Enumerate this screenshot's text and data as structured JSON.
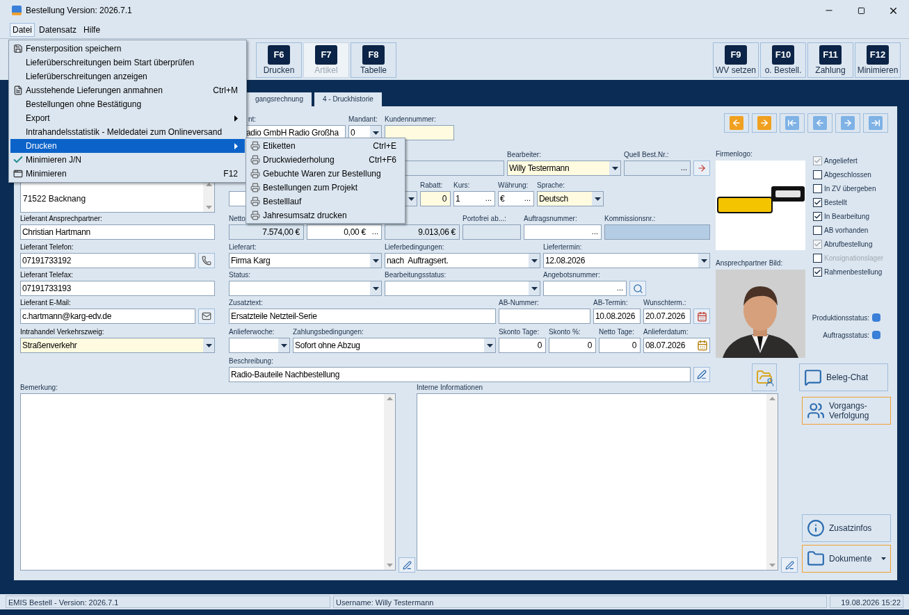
{
  "window": {
    "title": "Bestellung Version: 2026.7.1"
  },
  "menubar": [
    {
      "label": "Datei",
      "selected": true
    },
    {
      "label": "Datensatz",
      "selected": false
    },
    {
      "label": "Hilfe",
      "selected": false
    }
  ],
  "toolbar_left": [
    {
      "key": "F6",
      "label": "Drucken",
      "disabled": false
    },
    {
      "key": "F7",
      "label": "Artikel",
      "disabled": true
    },
    {
      "key": "F8",
      "label": "Tabelle",
      "disabled": false
    }
  ],
  "toolbar_right": [
    {
      "key": "F9",
      "label": "WV setzen",
      "disabled": false
    },
    {
      "key": "F10",
      "label": "o. Bestell.",
      "disabled": false
    },
    {
      "key": "F11",
      "label": "Zahlung",
      "disabled": false
    },
    {
      "key": "F12",
      "label": "Minimieren",
      "disabled": false
    }
  ],
  "tabs": [
    {
      "label": "gangsrechnung",
      "selected": false
    },
    {
      "label": "4 - Druckhistorie",
      "selected": false
    }
  ],
  "nav_buttons": [
    {
      "kind": "previous",
      "disabled": false
    },
    {
      "kind": "next",
      "disabled": false
    },
    {
      "kind": "first",
      "disabled": true
    },
    {
      "kind": "previous",
      "disabled": true
    },
    {
      "kind": "next",
      "disabled": true
    },
    {
      "kind": "last",
      "disabled": true
    }
  ],
  "address": {
    "value": "71522 Backnang"
  },
  "left_fields": [
    {
      "label": "Lieferant Ansprechpartner:",
      "value": "Christian Hartmann",
      "kind": "text",
      "highlighted": false,
      "readonly": false
    },
    {
      "label": "Lieferant Telefon:",
      "value": "07191733192",
      "kind": "text",
      "highlighted": false,
      "readonly": false
    },
    {
      "label": "Lieferant Telefax:",
      "value": "07191733193",
      "kind": "text",
      "highlighted": false,
      "readonly": false
    },
    {
      "label": "Lieferant E-Mail:",
      "value": "c.hartmann@karg-edv.de",
      "kind": "text",
      "highlighted": false,
      "readonly": false
    },
    {
      "label": "Intrahandel Verkehrszweig:",
      "value": "Straßenverkehr",
      "kind": "dropdown",
      "highlighted": true,
      "readonly": false
    }
  ],
  "middle_rows": [
    [
      {
        "label": "nt:",
        "value": "adio GmbH Radio Großha",
        "kind": "text",
        "highlighted": false,
        "readonly": false
      },
      {
        "label": "Mandant:",
        "value": "0",
        "kind": "dropdown",
        "highlighted": false,
        "readonly": false
      },
      {
        "label": "Kundennummer:",
        "kind": "text",
        "highlighted": true,
        "readonly": false
      }
    ],
    [
      {
        "kind": "text",
        "highlighted": false,
        "readonly": true
      },
      {
        "label": "Bearbeiter:",
        "value": "Willy Testermann",
        "kind": "dropdown",
        "highlighted": true,
        "readonly": false
      },
      {
        "label": "Quell Best.Nr.:",
        "kind": "text",
        "highlighted": false,
        "readonly": true,
        "button": "..."
      }
    ],
    [
      {
        "kind": "dropdown",
        "highlighted": false,
        "readonly": false
      },
      {
        "label": "Rabatt:",
        "value": "0",
        "kind": "number",
        "highlighted": true,
        "readonly": false
      },
      {
        "label": "Kurs:",
        "value": "1",
        "kind": "text",
        "highlighted": false,
        "readonly": false,
        "button": "..."
      },
      {
        "label": "Währung:",
        "value": "€",
        "kind": "text",
        "highlighted": false,
        "readonly": false,
        "button": "..."
      },
      {
        "label": "Sprache:",
        "value": "Deutsch",
        "kind": "dropdown",
        "highlighted": true,
        "readonly": false
      }
    ],
    [
      {
        "label": "Netto",
        "value": "7.574,00 €",
        "kind": "number",
        "highlighted": false,
        "readonly": true
      },
      {
        "value": "0,00 €",
        "kind": "number",
        "highlighted": false,
        "readonly": false,
        "button": "..."
      },
      {
        "value": "9.013,06 €",
        "kind": "number",
        "highlighted": false,
        "readonly": true
      },
      {
        "label": "Portofrei ab...:",
        "kind": "text",
        "highlighted": false,
        "readonly": true
      },
      {
        "label": "Auftragsnummer:",
        "kind": "text",
        "highlighted": false,
        "readonly": false,
        "button": "..."
      },
      {
        "label": "Kommissionsnr.:",
        "kind": "text",
        "highlighted": true,
        "readonly": true
      }
    ],
    [
      {
        "label": "Lieferart:",
        "value": "Firma Karg",
        "kind": "dropdown",
        "highlighted": false,
        "readonly": false
      },
      {
        "label": "Lieferbedingungen:",
        "value": "nach  Auftragsert.",
        "kind": "dropdown",
        "highlighted": false,
        "readonly": false
      },
      {
        "label": "Liefertermin:",
        "value": "12.08.2026",
        "kind": "dropdown",
        "highlighted": false,
        "readonly": false
      }
    ],
    [
      {
        "label": "Status:",
        "kind": "dropdown",
        "highlighted": false,
        "readonly": false
      },
      {
        "label": "Bearbeitungsstatus:",
        "kind": "dropdown",
        "highlighted": false,
        "readonly": false
      },
      {
        "label": "Angebotsnummer:",
        "kind": "text",
        "highlighted": false,
        "readonly": false,
        "button": "..."
      }
    ],
    [
      {
        "label": "Zusatztext:",
        "value": "Ersatzteile Netzteil-Serie",
        "kind": "text",
        "highlighted": false,
        "readonly": false
      },
      {
        "label": "AB-Nummer:",
        "kind": "text",
        "highlighted": false,
        "readonly": false
      },
      {
        "label": "AB-Termin:",
        "value": "10.08.2026",
        "kind": "text",
        "highlighted": false,
        "readonly": false
      },
      {
        "label": "Wunschterm.:",
        "value": "20.07.2026",
        "kind": "text",
        "highlighted": false,
        "readonly": false
      }
    ],
    [
      {
        "label": "Anlieferwoche:",
        "kind": "dropdown",
        "highlighted": false,
        "readonly": false
      },
      {
        "label": "Zahlungsbedingungen:",
        "value": "Sofort ohne Abzug",
        "kind": "dropdown",
        "highlighted": false,
        "readonly": false
      },
      {
        "label": "Skonto Tage:",
        "value": "0",
        "kind": "number",
        "highlighted": false,
        "readonly": false
      },
      {
        "label": "Skonto %:",
        "value": "0",
        "kind": "number",
        "highlighted": false,
        "readonly": false
      },
      {
        "label": "Netto Tage:",
        "value": "0",
        "kind": "number",
        "highlighted": false,
        "readonly": false
      },
      {
        "label": "Anlieferdatum:",
        "value": "08.07.2026",
        "kind": "date",
        "highlighted": false,
        "readonly": false
      }
    ],
    [
      {
        "label": "Beschreibung:",
        "value": "Radio-Bauteile Nachbestellung",
        "kind": "text",
        "highlighted": false,
        "readonly": false
      }
    ]
  ],
  "logo_label": "Firmenlogo:",
  "photo_label": "Ansprechpartner Bild:",
  "checkboxes": [
    {
      "label": "Angeliefert",
      "checked": true,
      "disabled": true,
      "dimmed": false
    },
    {
      "label": "Abgeschlossen",
      "checked": false,
      "disabled": false,
      "dimmed": false
    },
    {
      "label": "In ZV übergeben",
      "checked": false,
      "disabled": false,
      "dimmed": false
    },
    {
      "label": "Bestellt",
      "checked": true,
      "disabled": false,
      "dimmed": false
    },
    {
      "label": "In Bearbeitung",
      "checked": true,
      "disabled": false,
      "dimmed": false
    },
    {
      "label": "AB vorhanden",
      "checked": false,
      "disabled": false,
      "dimmed": false
    },
    {
      "label": "Abrufbestellung",
      "checked": true,
      "disabled": true,
      "dimmed": false
    },
    {
      "label": "Konsignationslager",
      "checked": false,
      "disabled": false,
      "dimmed": true
    },
    {
      "label": "Rahmenbestellung",
      "checked": true,
      "disabled": false,
      "dimmed": false
    }
  ],
  "status_indicators": [
    {
      "label": "Produktionsstatus:",
      "color": "#3a7fd8"
    },
    {
      "label": "Auftragsstatus:",
      "color": "#3a7fd8"
    }
  ],
  "side_buttons": [
    {
      "label": "Beleg-Chat",
      "kind": "chat",
      "highlighted": false
    },
    {
      "label": "Vorgangs-Verfolgung",
      "kind": "tracking",
      "highlighted": true
    },
    {
      "label": "Zusatzinfos",
      "kind": "info",
      "highlighted": false
    },
    {
      "label": "Dokumente",
      "kind": "documents",
      "highlighted": true
    }
  ],
  "notes": [
    {
      "label": "Bemerkung:"
    },
    {
      "label": "Interne Informationen"
    }
  ],
  "status_bar": [
    "EMIS Bestell - Version: 2026.7.1",
    "Username: Willy Testermann",
    "19.08.2026 15:22"
  ],
  "menu": [
    {
      "label": "Fensterposition speichern",
      "kind": "disk",
      "selected": false,
      "checked": false
    },
    {
      "label": "Lieferüberschreitungen beim Start überprüfen",
      "kind": "plain",
      "selected": false,
      "checked": false
    },
    {
      "label": "Lieferüberschreitungen anzeigen",
      "kind": "plain",
      "selected": false,
      "checked": false
    },
    {
      "label": "Ausstehende Lieferungen anmahnen",
      "shortcut": "Ctrl+M",
      "kind": "note",
      "selected": false,
      "checked": false
    },
    {
      "label": "Bestellungen ohne Bestätigung",
      "kind": "plain",
      "selected": false,
      "checked": false
    },
    {
      "label": "Export",
      "kind": "submenu",
      "selected": false,
      "checked": false
    },
    {
      "label": "Intrahandelsstatistik - Meldedatei zum Onlineversand",
      "kind": "plain",
      "selected": false,
      "checked": false
    },
    {
      "label": "Drucken",
      "kind": "submenu",
      "selected": true,
      "checked": false
    },
    {
      "label": "Minimieren J/N",
      "kind": "plain",
      "selected": false,
      "checked": true
    },
    {
      "label": "Minimieren",
      "shortcut": "F12",
      "kind": "window",
      "selected": false,
      "checked": false
    }
  ],
  "submenu": [
    {
      "label": "Etiketten",
      "shortcut": "Ctrl+E",
      "selected": false
    },
    {
      "label": "Druckwiederholung",
      "shortcut": "Ctrl+F6",
      "selected": false
    },
    {
      "label": "Gebuchte Waren zur Bestellung",
      "selected": false
    },
    {
      "label": "Bestellungen zum Projekt",
      "selected": false
    },
    {
      "label": "Bestelllauf",
      "selected": false
    },
    {
      "label": "Jahresumsatz drucken",
      "selected": false
    }
  ]
}
